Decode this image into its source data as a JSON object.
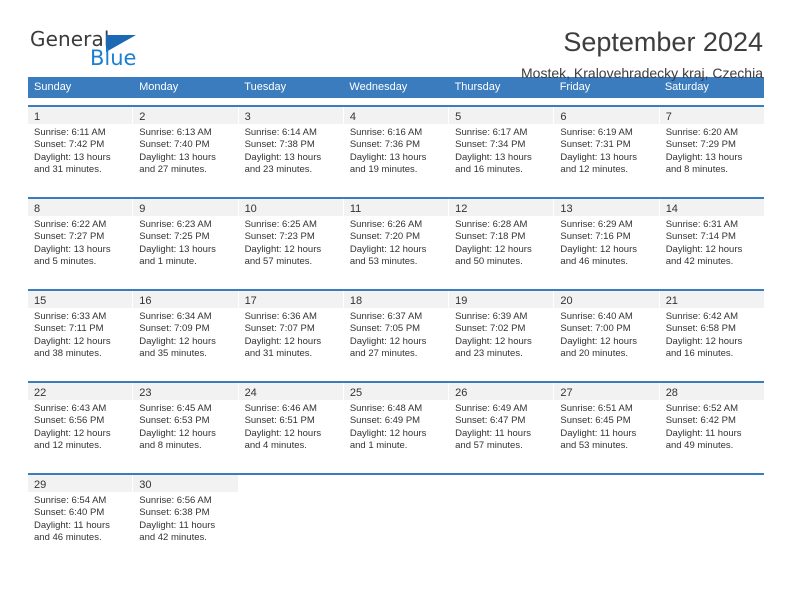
{
  "brand": {
    "word_top": "General",
    "word_bottom": "Blue",
    "triangle_color": "#1b68b3",
    "blue_color": "#1b7fd4"
  },
  "header": {
    "title": "September 2024",
    "subtitle": "Mostek, Kralovehradecky kraj, Czechia"
  },
  "theme": {
    "header_blue": "#3a7cbe",
    "day_band_gray": "#f2f2f2",
    "text": "#333333"
  },
  "weekdays": [
    "Sunday",
    "Monday",
    "Tuesday",
    "Wednesday",
    "Thursday",
    "Friday",
    "Saturday"
  ],
  "weeks": [
    [
      {
        "day": "1",
        "sunrise": "Sunrise: 6:11 AM",
        "sunset": "Sunset: 7:42 PM",
        "daylight1": "Daylight: 13 hours",
        "daylight2": "and 31 minutes."
      },
      {
        "day": "2",
        "sunrise": "Sunrise: 6:13 AM",
        "sunset": "Sunset: 7:40 PM",
        "daylight1": "Daylight: 13 hours",
        "daylight2": "and 27 minutes."
      },
      {
        "day": "3",
        "sunrise": "Sunrise: 6:14 AM",
        "sunset": "Sunset: 7:38 PM",
        "daylight1": "Daylight: 13 hours",
        "daylight2": "and 23 minutes."
      },
      {
        "day": "4",
        "sunrise": "Sunrise: 6:16 AM",
        "sunset": "Sunset: 7:36 PM",
        "daylight1": "Daylight: 13 hours",
        "daylight2": "and 19 minutes."
      },
      {
        "day": "5",
        "sunrise": "Sunrise: 6:17 AM",
        "sunset": "Sunset: 7:34 PM",
        "daylight1": "Daylight: 13 hours",
        "daylight2": "and 16 minutes."
      },
      {
        "day": "6",
        "sunrise": "Sunrise: 6:19 AM",
        "sunset": "Sunset: 7:31 PM",
        "daylight1": "Daylight: 13 hours",
        "daylight2": "and 12 minutes."
      },
      {
        "day": "7",
        "sunrise": "Sunrise: 6:20 AM",
        "sunset": "Sunset: 7:29 PM",
        "daylight1": "Daylight: 13 hours",
        "daylight2": "and 8 minutes."
      }
    ],
    [
      {
        "day": "8",
        "sunrise": "Sunrise: 6:22 AM",
        "sunset": "Sunset: 7:27 PM",
        "daylight1": "Daylight: 13 hours",
        "daylight2": "and 5 minutes."
      },
      {
        "day": "9",
        "sunrise": "Sunrise: 6:23 AM",
        "sunset": "Sunset: 7:25 PM",
        "daylight1": "Daylight: 13 hours",
        "daylight2": "and 1 minute."
      },
      {
        "day": "10",
        "sunrise": "Sunrise: 6:25 AM",
        "sunset": "Sunset: 7:23 PM",
        "daylight1": "Daylight: 12 hours",
        "daylight2": "and 57 minutes."
      },
      {
        "day": "11",
        "sunrise": "Sunrise: 6:26 AM",
        "sunset": "Sunset: 7:20 PM",
        "daylight1": "Daylight: 12 hours",
        "daylight2": "and 53 minutes."
      },
      {
        "day": "12",
        "sunrise": "Sunrise: 6:28 AM",
        "sunset": "Sunset: 7:18 PM",
        "daylight1": "Daylight: 12 hours",
        "daylight2": "and 50 minutes."
      },
      {
        "day": "13",
        "sunrise": "Sunrise: 6:29 AM",
        "sunset": "Sunset: 7:16 PM",
        "daylight1": "Daylight: 12 hours",
        "daylight2": "and 46 minutes."
      },
      {
        "day": "14",
        "sunrise": "Sunrise: 6:31 AM",
        "sunset": "Sunset: 7:14 PM",
        "daylight1": "Daylight: 12 hours",
        "daylight2": "and 42 minutes."
      }
    ],
    [
      {
        "day": "15",
        "sunrise": "Sunrise: 6:33 AM",
        "sunset": "Sunset: 7:11 PM",
        "daylight1": "Daylight: 12 hours",
        "daylight2": "and 38 minutes."
      },
      {
        "day": "16",
        "sunrise": "Sunrise: 6:34 AM",
        "sunset": "Sunset: 7:09 PM",
        "daylight1": "Daylight: 12 hours",
        "daylight2": "and 35 minutes."
      },
      {
        "day": "17",
        "sunrise": "Sunrise: 6:36 AM",
        "sunset": "Sunset: 7:07 PM",
        "daylight1": "Daylight: 12 hours",
        "daylight2": "and 31 minutes."
      },
      {
        "day": "18",
        "sunrise": "Sunrise: 6:37 AM",
        "sunset": "Sunset: 7:05 PM",
        "daylight1": "Daylight: 12 hours",
        "daylight2": "and 27 minutes."
      },
      {
        "day": "19",
        "sunrise": "Sunrise: 6:39 AM",
        "sunset": "Sunset: 7:02 PM",
        "daylight1": "Daylight: 12 hours",
        "daylight2": "and 23 minutes."
      },
      {
        "day": "20",
        "sunrise": "Sunrise: 6:40 AM",
        "sunset": "Sunset: 7:00 PM",
        "daylight1": "Daylight: 12 hours",
        "daylight2": "and 20 minutes."
      },
      {
        "day": "21",
        "sunrise": "Sunrise: 6:42 AM",
        "sunset": "Sunset: 6:58 PM",
        "daylight1": "Daylight: 12 hours",
        "daylight2": "and 16 minutes."
      }
    ],
    [
      {
        "day": "22",
        "sunrise": "Sunrise: 6:43 AM",
        "sunset": "Sunset: 6:56 PM",
        "daylight1": "Daylight: 12 hours",
        "daylight2": "and 12 minutes."
      },
      {
        "day": "23",
        "sunrise": "Sunrise: 6:45 AM",
        "sunset": "Sunset: 6:53 PM",
        "daylight1": "Daylight: 12 hours",
        "daylight2": "and 8 minutes."
      },
      {
        "day": "24",
        "sunrise": "Sunrise: 6:46 AM",
        "sunset": "Sunset: 6:51 PM",
        "daylight1": "Daylight: 12 hours",
        "daylight2": "and 4 minutes."
      },
      {
        "day": "25",
        "sunrise": "Sunrise: 6:48 AM",
        "sunset": "Sunset: 6:49 PM",
        "daylight1": "Daylight: 12 hours",
        "daylight2": "and 1 minute."
      },
      {
        "day": "26",
        "sunrise": "Sunrise: 6:49 AM",
        "sunset": "Sunset: 6:47 PM",
        "daylight1": "Daylight: 11 hours",
        "daylight2": "and 57 minutes."
      },
      {
        "day": "27",
        "sunrise": "Sunrise: 6:51 AM",
        "sunset": "Sunset: 6:45 PM",
        "daylight1": "Daylight: 11 hours",
        "daylight2": "and 53 minutes."
      },
      {
        "day": "28",
        "sunrise": "Sunrise: 6:52 AM",
        "sunset": "Sunset: 6:42 PM",
        "daylight1": "Daylight: 11 hours",
        "daylight2": "and 49 minutes."
      }
    ],
    [
      {
        "day": "29",
        "sunrise": "Sunrise: 6:54 AM",
        "sunset": "Sunset: 6:40 PM",
        "daylight1": "Daylight: 11 hours",
        "daylight2": "and 46 minutes."
      },
      {
        "day": "30",
        "sunrise": "Sunrise: 6:56 AM",
        "sunset": "Sunset: 6:38 PM",
        "daylight1": "Daylight: 11 hours",
        "daylight2": "and 42 minutes."
      },
      {
        "day": "",
        "sunrise": "",
        "sunset": "",
        "daylight1": "",
        "daylight2": ""
      },
      {
        "day": "",
        "sunrise": "",
        "sunset": "",
        "daylight1": "",
        "daylight2": ""
      },
      {
        "day": "",
        "sunrise": "",
        "sunset": "",
        "daylight1": "",
        "daylight2": ""
      },
      {
        "day": "",
        "sunrise": "",
        "sunset": "",
        "daylight1": "",
        "daylight2": ""
      },
      {
        "day": "",
        "sunrise": "",
        "sunset": "",
        "daylight1": "",
        "daylight2": ""
      }
    ]
  ]
}
